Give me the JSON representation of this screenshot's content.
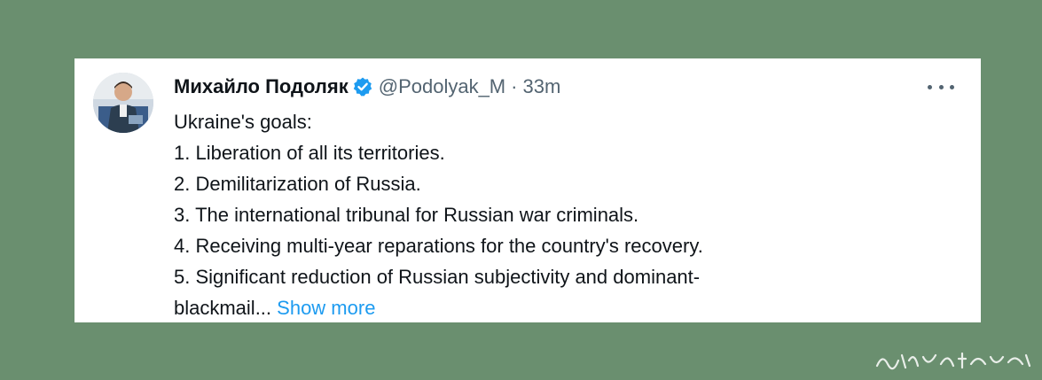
{
  "tweet": {
    "author_name": "Михайло Подоляк",
    "handle": "@Podolyak_M",
    "separator": "·",
    "time": "33m",
    "body_lines": [
      "Ukraine's goals:",
      "1. Liberation of all its territories.",
      "2. Demilitarization of Russia.",
      "3. The international tribunal for Russian war criminals.",
      "4. Receiving multi-year reparations for the country's recovery.",
      "5. Significant reduction of Russian subjectivity and dominant-"
    ],
    "last_line_text": "blackmail... ",
    "show_more_label": "Show more"
  },
  "icons": {
    "verified": "verified-badge-icon",
    "more": "more-options-icon"
  },
  "colors": {
    "background": "#6a8f6f",
    "card": "#ffffff",
    "text": "#0f1419",
    "secondary_text": "#536471",
    "link": "#1d9bf0",
    "verified_badge": "#1d9bf0"
  }
}
